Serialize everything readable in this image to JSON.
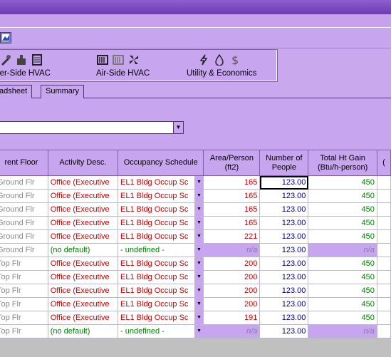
{
  "groups": [
    {
      "label": "ater-Side HVAC",
      "icons": [
        "pipe-tool-icon",
        "pump-icon",
        "chiller-icon"
      ]
    },
    {
      "label": "Air-Side HVAC",
      "icons": [
        "ahu-coil-icon",
        "fan-coil-icon",
        "fan-icon"
      ]
    },
    {
      "label": "Utility & Economics",
      "icons": [
        "electric-icon",
        "gas-drop-icon",
        "dollar-icon"
      ]
    }
  ],
  "tabs": [
    {
      "label": "adsheet",
      "active": true
    },
    {
      "label": "Summary",
      "active": false
    }
  ],
  "combo": {
    "value": ""
  },
  "columns": [
    "rent Floor",
    "Activity Desc.",
    "Occupancy Schedule",
    "Area/Person (ft2)",
    "Number of People",
    "Total Ht Gain (Btu/h-person)",
    "("
  ],
  "rows": [
    {
      "floor": "Ground Flr",
      "activity": "Office (Executive",
      "schedule": "EL1 Bldg Occup Sc",
      "area": "165",
      "people": "123.00",
      "gain": "450",
      "is_default": false
    },
    {
      "floor": "Ground Flr",
      "activity": "Office (Executive",
      "schedule": "EL1 Bldg Occup Sc",
      "area": "165",
      "people": "123.00",
      "gain": "450",
      "is_default": false
    },
    {
      "floor": "Ground Flr",
      "activity": "Office (Executive",
      "schedule": "EL1 Bldg Occup Sc",
      "area": "165",
      "people": "123.00",
      "gain": "450",
      "is_default": false
    },
    {
      "floor": "Ground Flr",
      "activity": "Office (Executive",
      "schedule": "EL1 Bldg Occup Sc",
      "area": "165",
      "people": "123.00",
      "gain": "450",
      "is_default": false
    },
    {
      "floor": "Ground Flr",
      "activity": "Office (Executive",
      "schedule": "EL1 Bldg Occup Sc",
      "area": "221",
      "people": "123.00",
      "gain": "450",
      "is_default": false
    },
    {
      "floor": "Ground Flr",
      "activity": "(no default)",
      "schedule": "- undefined -",
      "area": "n/a",
      "people": "123.00",
      "gain": "n/a",
      "is_default": true
    },
    {
      "floor": "Top Flr",
      "activity": "Office (Executive",
      "schedule": "EL1 Bldg Occup Sc",
      "area": "200",
      "people": "123.00",
      "gain": "450",
      "is_default": false
    },
    {
      "floor": "Top Flr",
      "activity": "Office (Executive",
      "schedule": "EL1 Bldg Occup Sc",
      "area": "200",
      "people": "123.00",
      "gain": "450",
      "is_default": false
    },
    {
      "floor": "Top Flr",
      "activity": "Office (Executive",
      "schedule": "EL1 Bldg Occup Sc",
      "area": "200",
      "people": "123.00",
      "gain": "450",
      "is_default": false
    },
    {
      "floor": "Top Flr",
      "activity": "Office (Executive",
      "schedule": "EL1 Bldg Occup Sc",
      "area": "200",
      "people": "123.00",
      "gain": "450",
      "is_default": false
    },
    {
      "floor": "Top Flr",
      "activity": "Office (Executive",
      "schedule": "EL1 Bldg Occup Sc",
      "area": "191",
      "people": "123.00",
      "gain": "450",
      "is_default": false
    },
    {
      "floor": "Top Flr",
      "activity": "(no default)",
      "schedule": "- undefined -",
      "area": "n/a",
      "people": "123.00",
      "gain": "n/a",
      "is_default": true
    }
  ],
  "colors": {
    "title": "#7a48c0",
    "panel": "#c8a6ef",
    "red_text": "#cc0000",
    "green_text": "#008000",
    "blue_text": "#000080"
  }
}
